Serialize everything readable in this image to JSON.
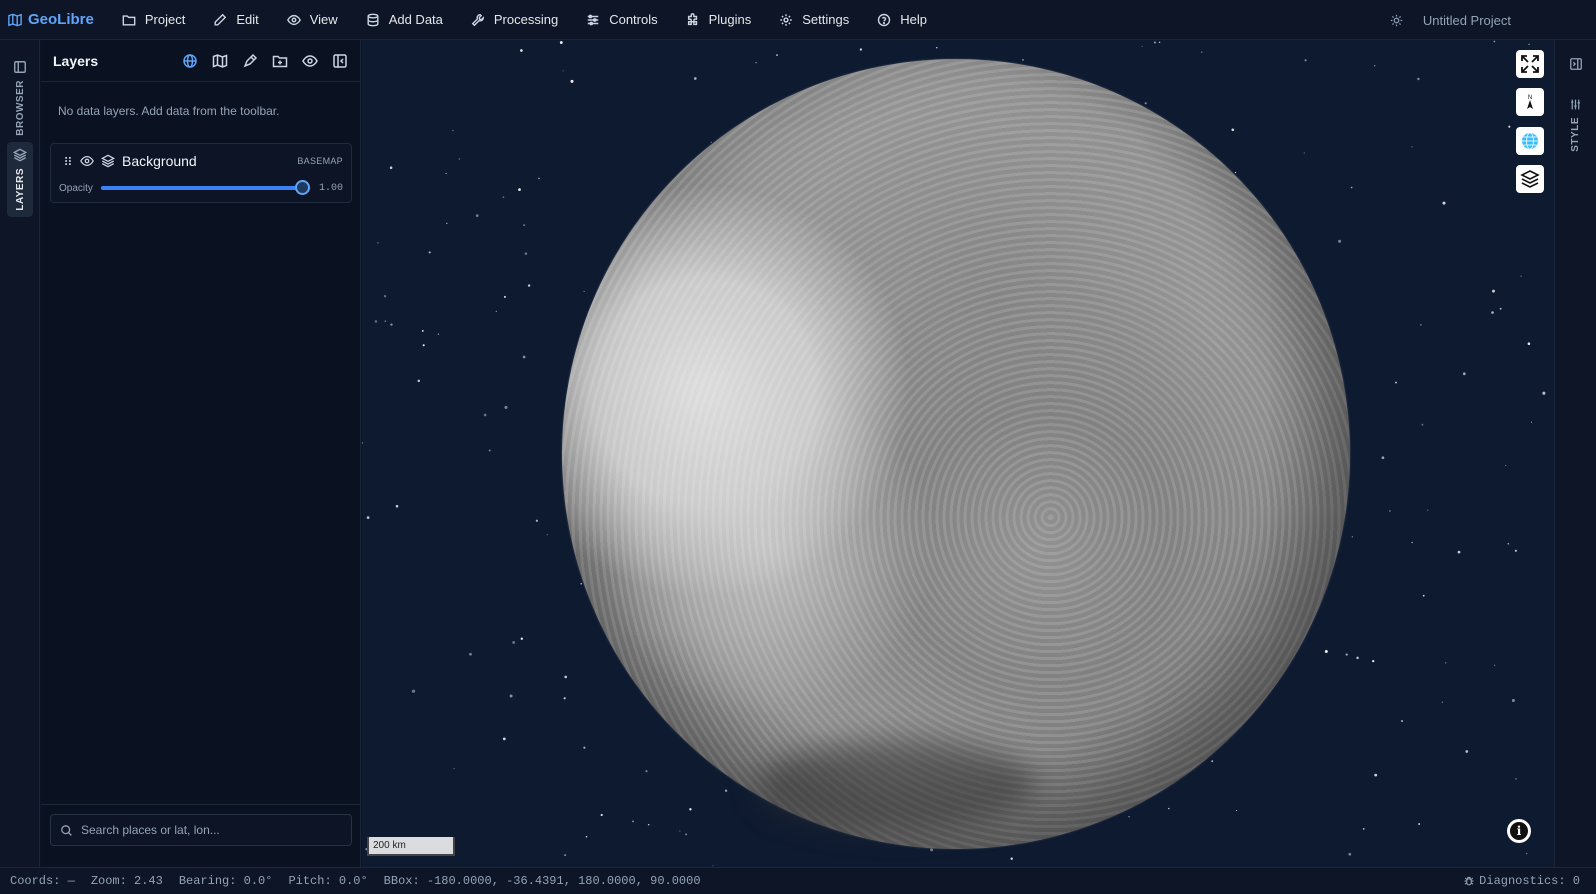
{
  "app": {
    "name": "GeoLibre",
    "project_title": "Untitled Project"
  },
  "menu": [
    {
      "label": "Project",
      "icon": "folder-icon"
    },
    {
      "label": "Edit",
      "icon": "pencil-icon"
    },
    {
      "label": "View",
      "icon": "eye-icon"
    },
    {
      "label": "Add Data",
      "icon": "database-icon"
    },
    {
      "label": "Processing",
      "icon": "wrench-icon"
    },
    {
      "label": "Controls",
      "icon": "sliders-icon"
    },
    {
      "label": "Plugins",
      "icon": "puzzle-icon"
    },
    {
      "label": "Settings",
      "icon": "gear-icon"
    },
    {
      "label": "Help",
      "icon": "help-circle-icon"
    }
  ],
  "rail": {
    "browser_label": "BROWSER",
    "layers_label": "LAYERS"
  },
  "layers_panel": {
    "title": "Layers",
    "empty_message": "No data layers. Add data from the toolbar.",
    "background_layer": {
      "name": "Background",
      "badge": "BASEMAP",
      "opacity_label": "Opacity",
      "opacity_value": "1.00",
      "opacity": 1.0
    }
  },
  "search": {
    "placeholder": "Search places or lat, lon..."
  },
  "map": {
    "scale_label": "200 km",
    "compass_label": "N"
  },
  "right_rail": {
    "style_label": "STYLE"
  },
  "status": {
    "coords": "Coords: —",
    "zoom": "Zoom: 2.43",
    "bearing": "Bearing: 0.0°",
    "pitch": "Pitch: 0.0°",
    "bbox": "BBox: -180.0000, -36.4391, 180.0000, 90.0000",
    "diagnostics": "Diagnostics: 0"
  },
  "colors": {
    "accent": "#60a5fa",
    "background": "#0b1424",
    "map_background": "#0e1a30"
  }
}
